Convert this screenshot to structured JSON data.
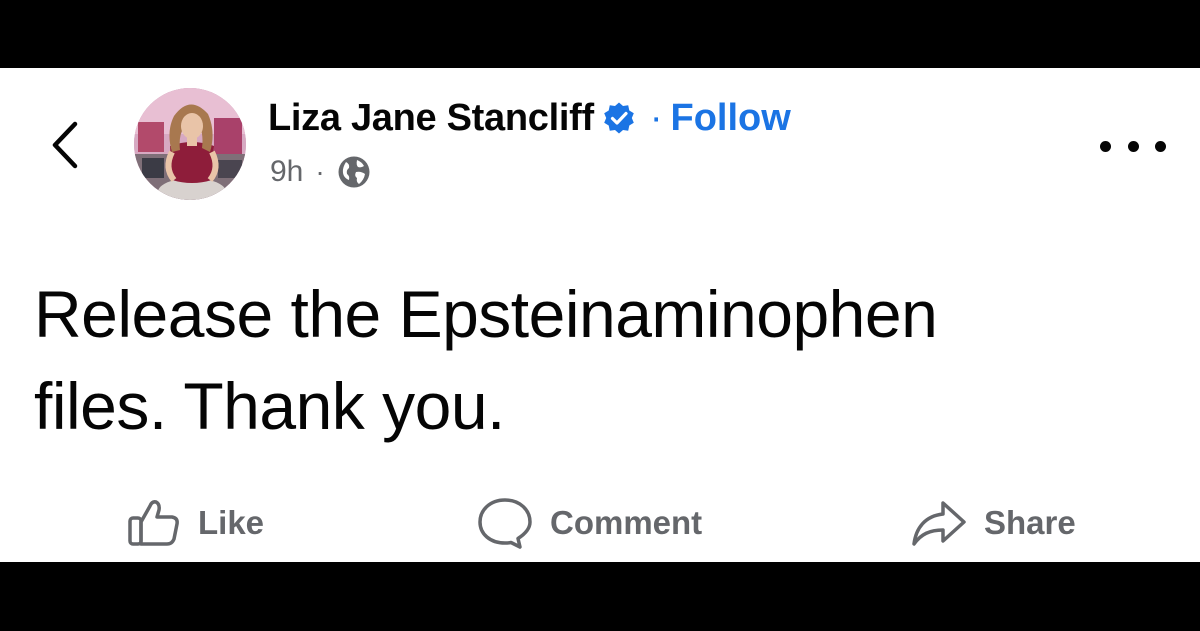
{
  "post": {
    "author_name": "Liza Jane Stancliff",
    "separator": "·",
    "follow_label": "Follow",
    "timestamp": "9h",
    "meta_separator": "·",
    "audience_icon": "globe-icon",
    "verified_icon": "verified-badge-icon",
    "text_lines": [
      "Release the Epsteinaminophen",
      "files. Thank you."
    ]
  },
  "actions": {
    "like_label": "Like",
    "comment_label": "Comment",
    "share_label": "Share"
  },
  "colors": {
    "accent": "#1b74e4",
    "text_primary": "#050505",
    "text_secondary": "#65676b",
    "background": "#ffffff",
    "letterbox": "#000000"
  }
}
